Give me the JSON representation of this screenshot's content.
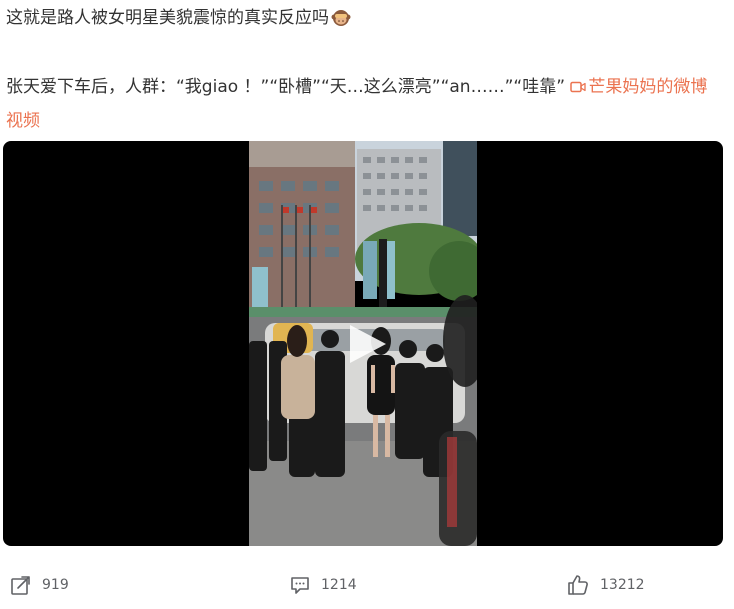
{
  "post": {
    "title": "这就是路人被女明星美貌震惊的真实反应吗",
    "title_emoji": "see-no-evil-monkey",
    "body_text": "张天爱下车后，人群：“我giao ！”“卧槽”“天…这么漂亮”“an……”“哇靠” ",
    "video_link_text": "芒果妈妈的微博视频",
    "video_link_icon": "video-camera-icon",
    "link_color": "#eb7350"
  },
  "video": {
    "play_icon": "play-icon",
    "background": "#000000"
  },
  "actions": {
    "repost": {
      "icon": "repost-icon",
      "count": "919"
    },
    "comment": {
      "icon": "comment-icon",
      "count": "1214"
    },
    "like": {
      "icon": "thumbs-up-icon",
      "count": "13212"
    }
  }
}
